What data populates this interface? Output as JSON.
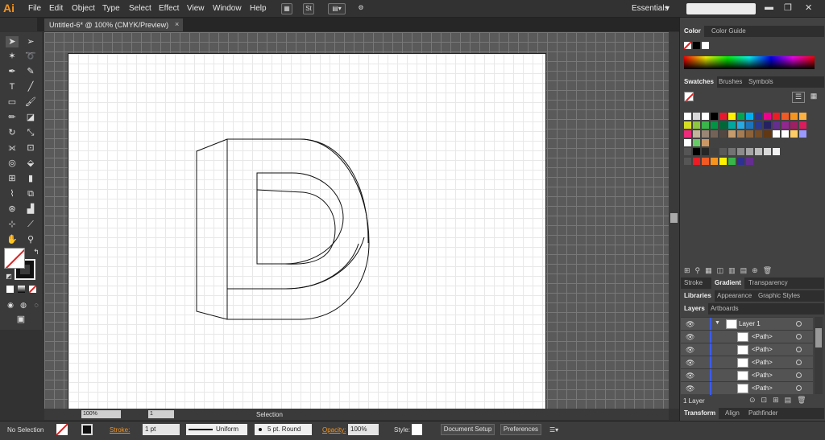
{
  "app": {
    "logo": "Ai",
    "workspace": "Essentials"
  },
  "menu": [
    "File",
    "Edit",
    "Object",
    "Type",
    "Select",
    "Effect",
    "View",
    "Window",
    "Help"
  ],
  "toolbar_top": {
    "st_label": "St"
  },
  "document": {
    "tab_title": "Untitled-6* @ 100% (CMYK/Preview)",
    "close": "×"
  },
  "statusbar": {
    "zoom": "100%",
    "artboard_num": "1",
    "tool_label": "Selection"
  },
  "controlbar": {
    "selection_label": "No Selection",
    "stroke_label": "Stroke:",
    "stroke_value": "1 pt",
    "profile_label": "Uniform",
    "brush_label": "5 pt. Round",
    "opacity_label": "Opacity:",
    "opacity_value": "100%",
    "style_label": "Style:",
    "doc_setup": "Document Setup",
    "preferences": "Preferences"
  },
  "panels": {
    "color": {
      "tabs": [
        "Color",
        "Color Guide"
      ]
    },
    "swatches": {
      "tabs": [
        "Swatches",
        "Brushes",
        "Symbols"
      ]
    },
    "stroke": {
      "tabs": [
        "Stroke",
        "Gradient",
        "Transparency"
      ]
    },
    "libraries": {
      "tabs": [
        "Libraries",
        "Appearance",
        "Graphic Styles"
      ]
    },
    "layers": {
      "tabs": [
        "Layers",
        "Artboards"
      ],
      "rows": [
        "Layer 1",
        "<Path>",
        "<Path>",
        "<Path>",
        "<Path>",
        "<Path>"
      ],
      "count": "1 Layer"
    },
    "transform": {
      "tabs": [
        "Transform",
        "Align",
        "Pathfinder"
      ]
    }
  },
  "colors": {
    "accent": "#f7941d",
    "layer_bar": "#3d5cff"
  }
}
